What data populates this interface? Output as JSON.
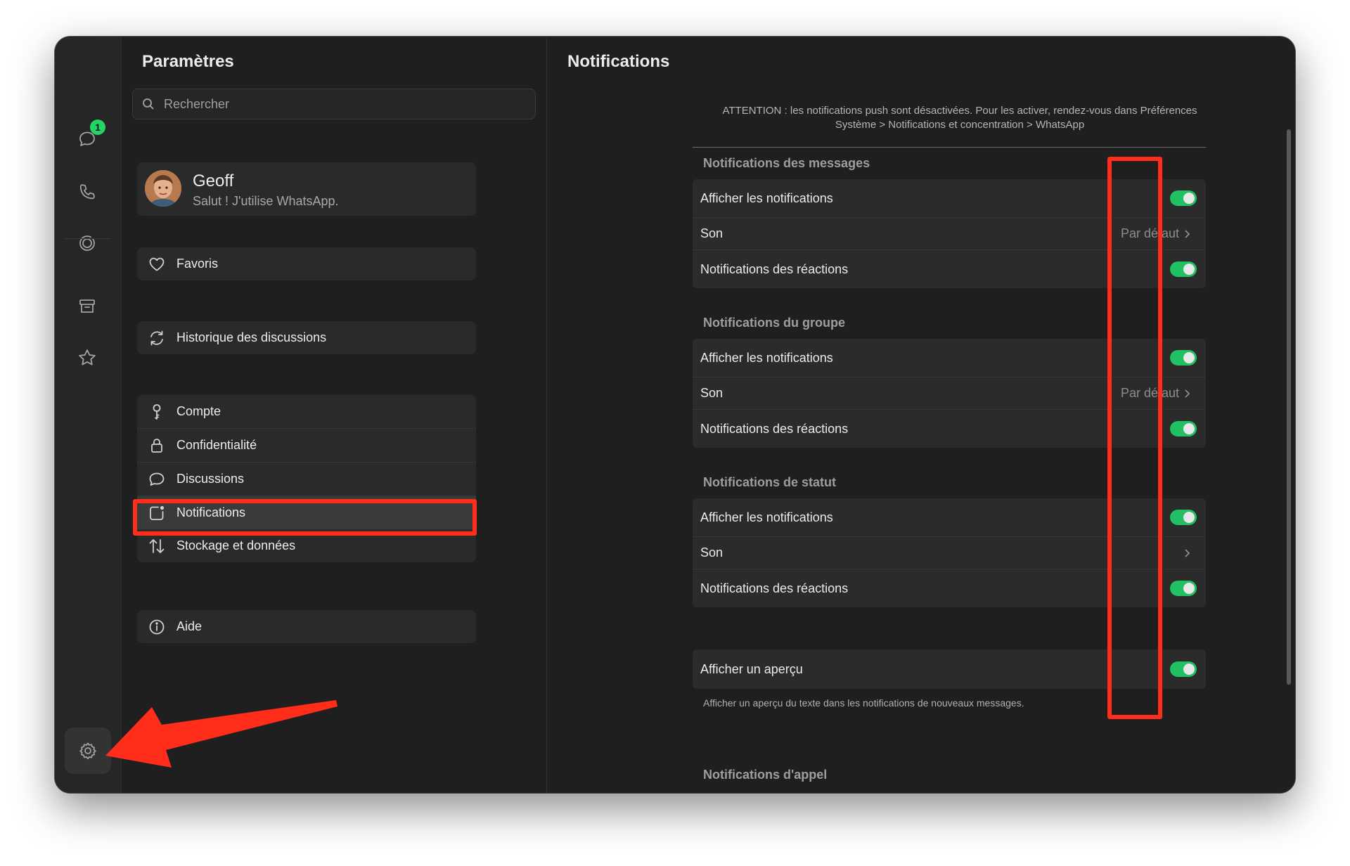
{
  "rail": {
    "chats_badge": "1",
    "icons": [
      "chats-icon",
      "calls-icon",
      "status-icon",
      "archive-icon",
      "starred-icon",
      "settings-icon"
    ]
  },
  "settings": {
    "title": "Paramètres",
    "search_placeholder": "Rechercher",
    "profile": {
      "name": "Geoff",
      "status": "Salut ! J'utilise WhatsApp."
    },
    "favorites": "Favoris",
    "chat_history": "Historique des discussions",
    "menu": [
      {
        "label": "Compte",
        "icon": "key-icon"
      },
      {
        "label": "Confidentialité",
        "icon": "lock-icon"
      },
      {
        "label": "Discussions",
        "icon": "chat-bubble-icon"
      },
      {
        "label": "Notifications",
        "icon": "notification-icon"
      },
      {
        "label": "Stockage et données",
        "icon": "up-down-arrows-icon"
      }
    ],
    "help": "Aide"
  },
  "notifications": {
    "title": "Notifications",
    "warning": "ATTENTION  : les notifications push sont désactivées. Pour les activer, rendez-vous dans Préférences Système > Notifications et concentration > WhatsApp",
    "messages": {
      "title": "Notifications des messages",
      "show": "Afficher les notifications",
      "sound": "Son",
      "sound_value": "Par défaut",
      "reactions": "Notifications des réactions"
    },
    "group": {
      "title": "Notifications du groupe",
      "show": "Afficher les notifications",
      "sound": "Son",
      "sound_value": "Par défaut",
      "reactions": "Notifications des réactions"
    },
    "status": {
      "title": "Notifications de statut",
      "show": "Afficher les notifications",
      "sound": "Son",
      "reactions": "Notifications des réactions"
    },
    "preview": {
      "label": "Afficher un aperçu",
      "description": "Afficher un aperçu du texte dans les notifications de nouveaux messages."
    },
    "calls": {
      "title": "Notifications d'appel"
    }
  },
  "colors": {
    "accent_green": "#21c063",
    "highlight_red": "#ff2d1a",
    "window_bg": "#1f1f1f"
  }
}
